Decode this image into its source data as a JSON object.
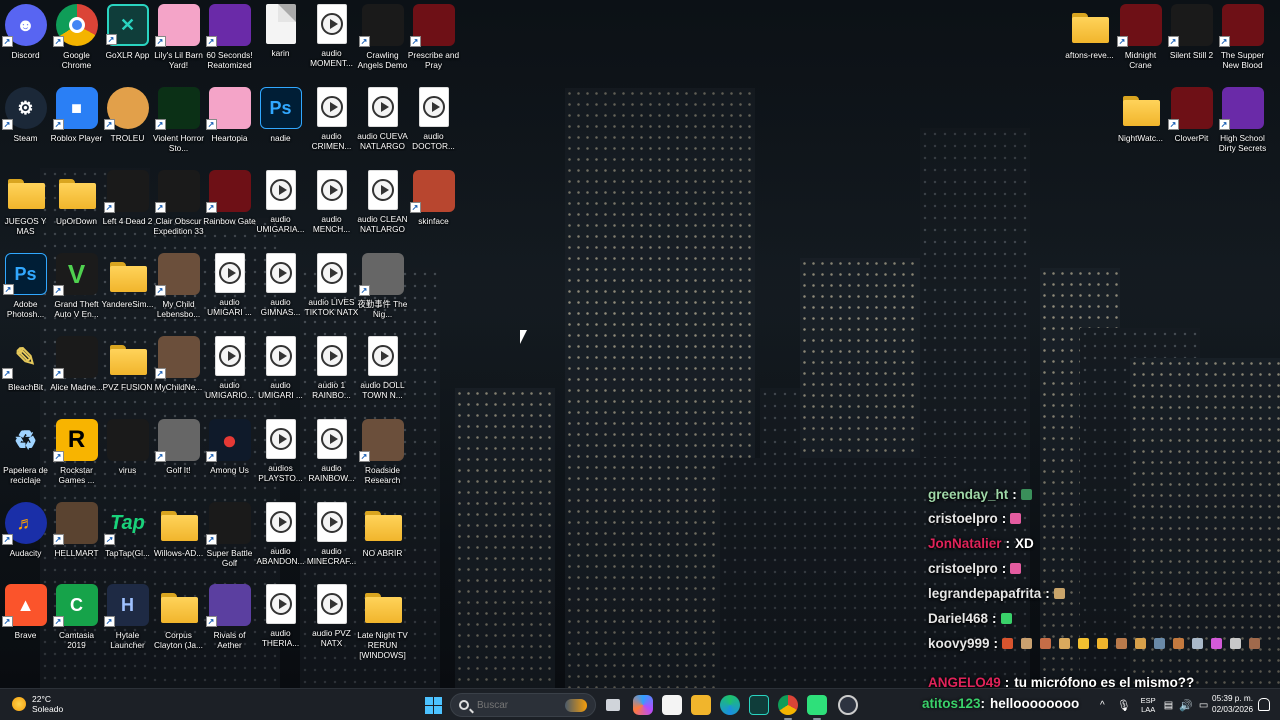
{
  "desktop_icons": [
    {
      "label": "Discord",
      "icon": "discord-icon",
      "shortcut": true
    },
    {
      "label": "Google Chrome",
      "icon": "chrome-icon",
      "shortcut": true
    },
    {
      "label": "GoXLR App",
      "icon": "goxlr-icon",
      "shortcut": true
    },
    {
      "label": "Lily's Lil Barn Yard!",
      "icon": "game-icon",
      "shortcut": true
    },
    {
      "label": "60 Seconds! Reatomized",
      "icon": "game-icon",
      "shortcut": true
    },
    {
      "label": "karin",
      "icon": "file-icon",
      "shortcut": false
    },
    {
      "label": "audio MOMENT...",
      "icon": "audio-file-icon",
      "shortcut": false
    },
    {
      "label": "Crawling Angels Demo",
      "icon": "game-icon",
      "shortcut": true
    },
    {
      "label": "Prescribe and Pray",
      "icon": "game-icon",
      "shortcut": true
    },
    {
      "label": "Steam",
      "icon": "steam-icon",
      "shortcut": true
    },
    {
      "label": "Roblox Player",
      "icon": "roblox-icon",
      "shortcut": true
    },
    {
      "label": "TROLEU",
      "icon": "game-icon",
      "shortcut": true
    },
    {
      "label": "Violent Horror Sto...",
      "icon": "game-icon",
      "shortcut": true
    },
    {
      "label": "Heartopia",
      "icon": "game-icon",
      "shortcut": true
    },
    {
      "label": "nadie",
      "icon": "photoshop-file-icon",
      "shortcut": false
    },
    {
      "label": "audio CRIMEN...",
      "icon": "audio-file-icon",
      "shortcut": false
    },
    {
      "label": "audio CUEVA NATLARGO",
      "icon": "audio-file-icon",
      "shortcut": false
    },
    {
      "label": "audio DOCTOR...",
      "icon": "audio-file-icon",
      "shortcut": false
    },
    {
      "label": "JUEGOS Y MAS",
      "icon": "folder-icon",
      "shortcut": false
    },
    {
      "label": "UpOrDown",
      "icon": "folder-icon",
      "shortcut": false
    },
    {
      "label": "Left 4 Dead 2",
      "icon": "game-icon",
      "shortcut": true
    },
    {
      "label": "Clair Obscur Expedition 33",
      "icon": "game-icon",
      "shortcut": true
    },
    {
      "label": "Rainbow Gate",
      "icon": "game-icon",
      "shortcut": true
    },
    {
      "label": "audio UMIGARIA...",
      "icon": "audio-file-icon",
      "shortcut": false
    },
    {
      "label": "audio MENCH...",
      "icon": "audio-file-icon",
      "shortcut": false
    },
    {
      "label": "audio CLEAN NATLARGO",
      "icon": "audio-file-icon",
      "shortcut": false
    },
    {
      "label": "skinface",
      "icon": "game-icon",
      "shortcut": true
    },
    {
      "label": "Adobe Photosh...",
      "icon": "photoshop-icon",
      "shortcut": true
    },
    {
      "label": "Grand Theft Auto V En...",
      "icon": "gta-icon",
      "shortcut": true
    },
    {
      "label": "YandereSim...",
      "icon": "folder-icon",
      "shortcut": false
    },
    {
      "label": "My Child Lebensbo...",
      "icon": "game-icon",
      "shortcut": true
    },
    {
      "label": "audio UMIGARI ...",
      "icon": "audio-file-icon",
      "shortcut": false
    },
    {
      "label": "audio GIMNAS...",
      "icon": "audio-file-icon",
      "shortcut": false
    },
    {
      "label": "audio LIVES TIKTOK NATX",
      "icon": "audio-file-icon",
      "shortcut": false
    },
    {
      "label": "夜勤事件 The Nig...",
      "icon": "game-icon",
      "shortcut": true
    },
    {
      "label": "BleachBit",
      "icon": "bleachbit-icon",
      "shortcut": true
    },
    {
      "label": "Alice Madne...",
      "icon": "game-icon",
      "shortcut": true
    },
    {
      "label": "PVZ FUSION",
      "icon": "folder-icon",
      "shortcut": false
    },
    {
      "label": "MyChildNe...",
      "icon": "game-icon",
      "shortcut": true
    },
    {
      "label": "audio UMIGARIO...",
      "icon": "audio-file-icon",
      "shortcut": false
    },
    {
      "label": "audio UMIGARI ...",
      "icon": "audio-file-icon",
      "shortcut": false
    },
    {
      "label": "audio 1 RAINBO...",
      "icon": "audio-file-icon",
      "shortcut": false
    },
    {
      "label": "audio DOLL TOWN N...",
      "icon": "audio-file-icon",
      "shortcut": false
    },
    {
      "label": "Papelera de reciclaje",
      "icon": "recycle-bin-icon",
      "shortcut": false
    },
    {
      "label": "Rockstar Games ...",
      "icon": "rockstar-icon",
      "shortcut": true
    },
    {
      "label": "virus",
      "icon": "game-icon",
      "shortcut": false
    },
    {
      "label": "Golf It!",
      "icon": "game-icon",
      "shortcut": true
    },
    {
      "label": "Among Us",
      "icon": "among-us-icon",
      "shortcut": true
    },
    {
      "label": "audios PLAYSTO...",
      "icon": "audio-file-icon",
      "shortcut": false
    },
    {
      "label": "audio RAINBOW...",
      "icon": "audio-file-icon",
      "shortcut": false
    },
    {
      "label": "Roadside Research",
      "icon": "game-icon",
      "shortcut": true
    },
    {
      "label": "Audacity",
      "icon": "audacity-icon",
      "shortcut": true
    },
    {
      "label": "HELLMART",
      "icon": "game-icon",
      "shortcut": true
    },
    {
      "label": "TapTap(Gl...",
      "icon": "taptap-icon",
      "shortcut": true
    },
    {
      "label": "Willows-AD...",
      "icon": "folder-icon",
      "shortcut": false
    },
    {
      "label": "Super Battle Golf",
      "icon": "game-icon",
      "shortcut": true
    },
    {
      "label": "audio ABANDON...",
      "icon": "audio-file-icon",
      "shortcut": false
    },
    {
      "label": "audio MINECRAF...",
      "icon": "audio-file-icon",
      "shortcut": false
    },
    {
      "label": "NO ABRIR",
      "icon": "folder-icon",
      "shortcut": false
    },
    {
      "label": "Brave",
      "icon": "brave-icon",
      "shortcut": true
    },
    {
      "label": "Camtasia 2019",
      "icon": "camtasia-icon",
      "shortcut": true
    },
    {
      "label": "Hytale Launcher",
      "icon": "hytale-icon",
      "shortcut": true
    },
    {
      "label": "Corpus Clayton (Ja...",
      "icon": "folder-icon",
      "shortcut": false
    },
    {
      "label": "Rivals of Aether",
      "icon": "game-icon",
      "shortcut": true
    },
    {
      "label": "audio THERIA...",
      "icon": "audio-file-icon",
      "shortcut": false
    },
    {
      "label": "audio PVZ NATX",
      "icon": "audio-file-icon",
      "shortcut": false
    },
    {
      "label": "Late Night TV RERUN [WINDOWS]",
      "icon": "folder-icon",
      "shortcut": false
    },
    {
      "label": "aftons-reve...",
      "icon": "folder-icon",
      "shortcut": false
    },
    {
      "label": "Midnight Crane",
      "icon": "game-icon",
      "shortcut": true
    },
    {
      "label": "Silent Still 2",
      "icon": "game-icon",
      "shortcut": true
    },
    {
      "label": "The Supper New Blood",
      "icon": "game-icon",
      "shortcut": true
    },
    {
      "label": "NightWatc...",
      "icon": "folder-icon",
      "shortcut": false
    },
    {
      "label": "CloverPit",
      "icon": "game-icon",
      "shortcut": true
    },
    {
      "label": "High School Dirty Secrets",
      "icon": "game-icon",
      "shortcut": true
    }
  ],
  "chat": {
    "messages": [
      {
        "user": "greenday_ht",
        "text": "",
        "user_color": "#9fd8a8",
        "emotes": [
          "#3a8f5a"
        ]
      },
      {
        "user": "cristoelpro",
        "text": "",
        "user_color": "#e6e6e6",
        "emotes": [
          "#e45ca0"
        ]
      },
      {
        "user": "JonNatalier",
        "text": "XD",
        "user_color": "#e0235a",
        "emotes": []
      },
      {
        "user": "cristoelpro",
        "text": "",
        "user_color": "#e6e6e6",
        "emotes": [
          "#e45ca0"
        ]
      },
      {
        "user": "legrandepapafrita",
        "text": "",
        "user_color": "#e6e6e6",
        "emotes": [
          "#c9a46a"
        ]
      },
      {
        "user": "Dariel468",
        "text": "",
        "user_color": "#e6e6e6",
        "emotes": [
          "#3ad16a"
        ]
      },
      {
        "user": "koovy999",
        "text": "",
        "user_color": "#e6e6e6",
        "emotes": [
          "#d8542e",
          "#caa170",
          "#c66d47",
          "#d9a95d",
          "#f2c030",
          "#f0b52c",
          "#b97a4b",
          "#d7a04a",
          "#6a8aa8",
          "#c47a3f",
          "#a9b8c8",
          "#d25ad8",
          "#c8c8c8",
          "#a06a4c"
        ]
      },
      {
        "user": "ANGELO49",
        "text": "tu micrófono es el mismo??",
        "user_color": "#e0235a",
        "emotes": []
      },
      {
        "user": "atitos123",
        "text": "helloooooooo",
        "user_color": "#3ad16a",
        "emotes": []
      }
    ]
  },
  "taskbar": {
    "weather_temp": "22°C",
    "weather_desc": "Soleado",
    "search_placeholder": "Buscar",
    "language": "ESP",
    "language_sub": "LAA",
    "time": "05:39 p. m.",
    "date": "02/03/2026"
  },
  "colors": {
    "accent": "#4cc2ff",
    "folder": "#f1b52c",
    "taskbar_bg": "#1c2026"
  }
}
